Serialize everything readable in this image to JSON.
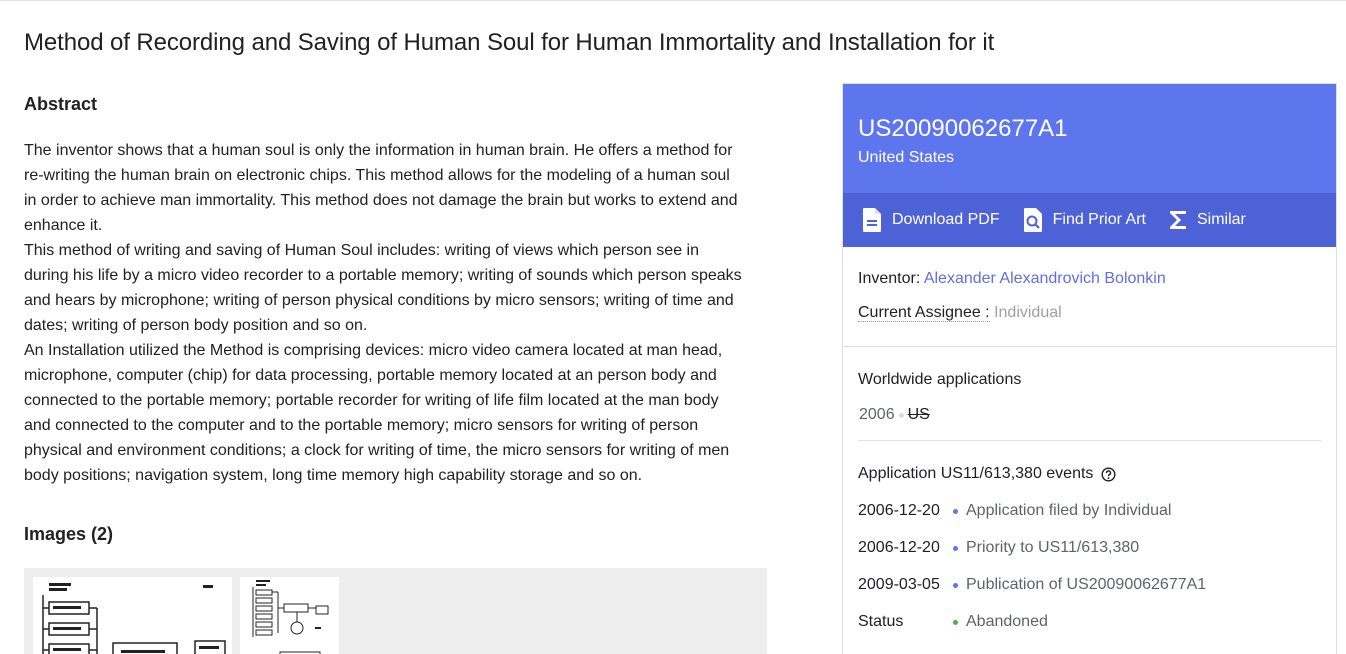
{
  "title": "Method of Recording and Saving of Human Soul for Human Immortality and Installation for it",
  "abstract": {
    "heading": "Abstract",
    "paragraphs": [
      "The inventor shows that a human soul is only the information in human brain. He offers a method for re-writing the human brain on electronic chips. This method allows for the modeling of a human soul in order to achieve man immortality. This method does not damage the brain but works to extend and enhance it.",
      "This method of writing and saving of Human Soul includes: writing of views which person see in during his life by a micro video recorder to a portable memory; writing of sounds which person speaks and hears by microphone; writing of person physical conditions by micro sensors; writing of time and dates; writing of person body position and so on.",
      "An Installation utilized the Method is comprising devices: micro video camera located at man head, microphone, computer (chip) for data processing, portable memory located at an person body and connected to the portable memory; portable recorder for writing of life film located at the man body and connected to the computer and to the portable memory; micro sensors for writing of person physical and environment conditions; a clock for writing of time, the micro sensors for writing of men body positions; navigation system, long time memory high capability storage and so on."
    ]
  },
  "images": {
    "heading": "Images (2)"
  },
  "panel": {
    "pub_number": "US20090062677A1",
    "country": "United States",
    "actions": {
      "download": "Download PDF",
      "prior_art": "Find Prior Art",
      "similar": "Similar"
    },
    "inventor_label": "Inventor:",
    "inventor_name": "Alexander Alexandrovich Bolonkin",
    "assignee_label": "Current Assignee :",
    "assignee_value": "Individual",
    "worldwide": {
      "heading": "Worldwide applications",
      "year": "2006",
      "country": "US"
    },
    "events": {
      "heading": "Application US11/613,380 events",
      "items": [
        {
          "date": "2006-12-20",
          "desc": "Application filed by Individual"
        },
        {
          "date": "2006-12-20",
          "desc": "Priority to US11/613,380"
        },
        {
          "date": "2009-03-05",
          "desc": "Publication of US20090062677A1"
        }
      ],
      "status_label": "Status",
      "status_value": "Abandoned"
    }
  },
  "colors": {
    "accent": "#5d76ee",
    "accent_dark": "#4d62d6",
    "link": "#5f6ee3",
    "status": "#4caf50"
  },
  "icons": [
    "pdf-icon",
    "search-doc-icon",
    "sigma-icon",
    "help-icon"
  ]
}
